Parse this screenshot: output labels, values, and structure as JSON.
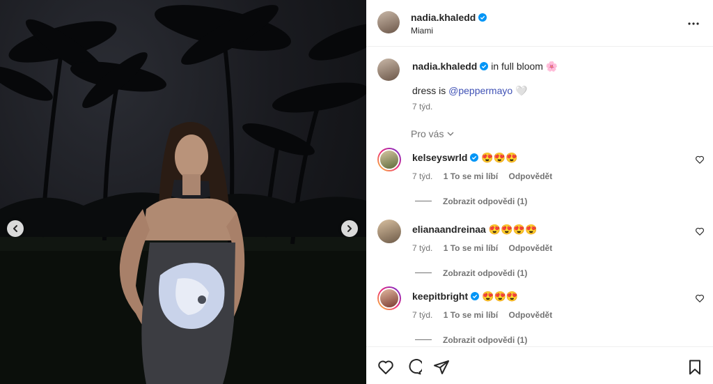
{
  "post": {
    "username": "nadia.khaledd",
    "location": "Miami"
  },
  "caption": {
    "username": "nadia.khaledd",
    "text": "in full bloom 🌸",
    "line2_prefix": "dress is ",
    "mention": "@peppermayo",
    "line2_suffix": " 🤍",
    "time": "7 týd."
  },
  "for_you": {
    "label": "Pro vás"
  },
  "comments": [
    {
      "username": "kelseyswrld",
      "verified": true,
      "text": "😍😍😍",
      "time": "7 týd.",
      "likes": "1 To se mi líbí",
      "reply": "Odpovědět",
      "view_replies": "Zobrazit odpovědi (1)"
    },
    {
      "username": "elianaandreinaa",
      "verified": false,
      "text": "😍😍😍😍",
      "time": "7 týd.",
      "likes": "1 To se mi líbí",
      "reply": "Odpovědět",
      "view_replies": "Zobrazit odpovědi (1)"
    },
    {
      "username": "keepitbright",
      "verified": true,
      "text": "😍😍😍",
      "time": "7 týd.",
      "likes": "1 To se mi líbí",
      "reply": "Odpovědět",
      "view_replies": "Zobrazit odpovědi (1)"
    }
  ],
  "icons": {
    "verified": "verified-badge-icon",
    "more": "more-options-icon",
    "prev": "chevron-left-icon",
    "next": "chevron-right-icon",
    "like": "heart-icon",
    "comment": "comment-icon",
    "share": "share-icon",
    "save": "bookmark-icon"
  },
  "colors": {
    "verified": "#0095f6",
    "mention": "#3f51b5",
    "secondary_text": "#737373"
  }
}
